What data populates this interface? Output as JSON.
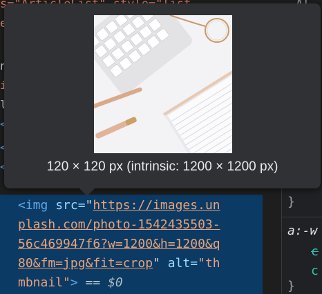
{
  "background_code": {
    "top_fragment": "s=\"ArticleList\" style=\"list",
    "top_right_fragment": "Al",
    "gutter_fragments": [
      "e",
      "n",
      "i",
      "l",
      "<",
      "<",
      "<"
    ],
    "selected_element": {
      "line1_open": "<img ",
      "line1_attr": "src=",
      "line1_quote": "\"",
      "line1_url": "https://images.un",
      "line2_url": "plash.com/photo-1542435503-",
      "line3_url": "56c469947f6?w=1200&h=1200&q",
      "line4_url": "80&fm=jpg&fit=crop",
      "line4_quote": "\"",
      "line4_attr": " alt=",
      "line4_value": "\"th",
      "line5_value": "mbnail\"",
      "line5_close": ">",
      "line5_eq": " == ",
      "line5_dollar": "$0"
    }
  },
  "styles_panel": {
    "brace_close_1": "}",
    "selector": "a:-w",
    "prop1": "c",
    "prop2": "c",
    "brace_close_2": "}"
  },
  "tooltip": {
    "caption": "120 × 120 px (intrinsic: 1200 × 1200 px)",
    "image": "desk-flatlay-thumbnail"
  },
  "colors": {
    "tooltip_bg": "#303134",
    "selection_bg": "#0b3a64",
    "tag": "#5fa8e8",
    "string": "#eaa377"
  }
}
